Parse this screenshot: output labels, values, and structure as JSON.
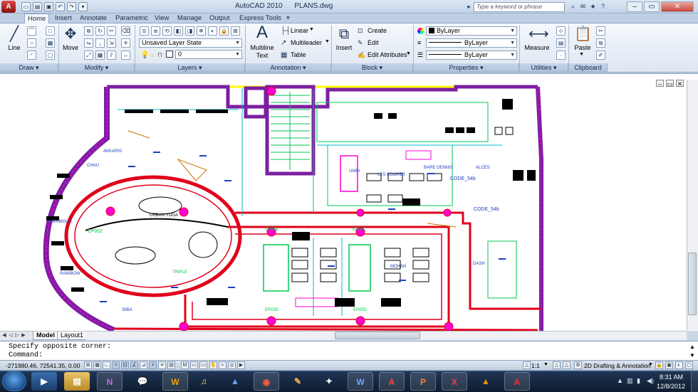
{
  "app": {
    "title": "AutoCAD 2010",
    "file": "PLANS.dwg",
    "app_button": "A",
    "search_placeholder": "Type a keyword or phrase"
  },
  "tabs": [
    "Home",
    "Insert",
    "Annotate",
    "Parametric",
    "View",
    "Manage",
    "Output",
    "Express Tools"
  ],
  "ribbon": {
    "draw": {
      "title": "Draw",
      "line": "Line"
    },
    "modify": {
      "title": "Modify",
      "move": "Move"
    },
    "layers": {
      "title": "Layers",
      "layer_state": "Unsaved Layer State",
      "current_layer": "0"
    },
    "annotation": {
      "title": "Annotation",
      "mtext_line1": "Multiline",
      "mtext_line2": "Text",
      "linear": "Linear",
      "multileader": "Multileader",
      "table": "Table"
    },
    "block": {
      "title": "Block",
      "insert": "Insert",
      "create": "Create",
      "edit": "Edit",
      "edit_attributes": "Edit Attributes"
    },
    "properties": {
      "title": "Properties",
      "color": "ByLayer",
      "linetype": "ByLayer",
      "lineweight": "ByLayer"
    },
    "utilities": {
      "title": "Utilities",
      "measure": "Measure"
    },
    "clipboard": {
      "title": "Clipboard",
      "paste": "Paste"
    }
  },
  "layout_tabs": [
    "Model",
    "Layout1"
  ],
  "command": {
    "history": "Specify opposite corner:",
    "prompt": "Command:"
  },
  "status": {
    "coordinates": "-271980.46, 72541.35, 0.00",
    "scale": "1:1",
    "workspace": "2D Drafting & Annotation"
  },
  "taskbar": {
    "time": "8:31 AM",
    "date": "12/8/2012",
    "apps": [
      "media-player",
      "file-explorer",
      "onenote",
      "chat",
      "word-doc",
      "itunes",
      "vlc-blue",
      "chrome",
      "word",
      "acrobat",
      "powerpoint",
      "office-app",
      "media-player-cone",
      "autocad"
    ]
  },
  "drawing_labels": {
    "l1": "CODE_54b",
    "l2": "CODE_54b",
    "l3": "UMBI",
    "l4": "LES COOPER",
    "l5": "BARE DENNIS",
    "l6": "ALCES",
    "l7": "AKKARIS",
    "l8": "CHAU",
    "l9": "KIMAMOUR",
    "l10": "RAINBOW",
    "l11": "BIBA",
    "l12": "URBAN YOGA",
    "l13": "MOHAN",
    "l14": "DASH",
    "l15": "EP002",
    "l16": "EP03B",
    "l17": "EP04C",
    "l18": "EP03D",
    "l19": "EP05D",
    "l20": "TRIPLE"
  },
  "colors": {
    "purple_wall": "#7b1fa2",
    "red_wall": "#e0001b",
    "yellow": "#ffff00",
    "green": "#00c853",
    "blue_text": "#1f3fbf",
    "magenta": "#ff00d4"
  }
}
